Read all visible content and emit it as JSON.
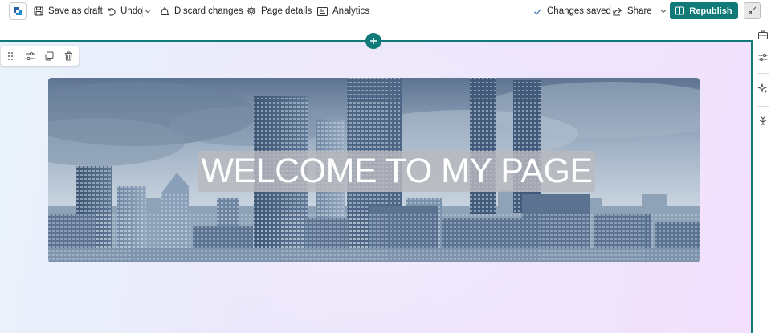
{
  "toolbar": {
    "logo_icon": "sharepoint-logo-icon",
    "save_draft": "Save as draft",
    "undo": "Undo",
    "discard": "Discard changes",
    "page_details": "Page details",
    "analytics": "Analytics",
    "status": "Changes saved",
    "share": "Share",
    "republish": "Republish"
  },
  "hero": {
    "title": "WELCOME TO MY PAGE"
  },
  "section_tools": [
    "drag-handle-icon",
    "section-settings-icon",
    "duplicate-icon",
    "delete-icon"
  ],
  "right_rail": [
    "toolbox-icon",
    "properties-icon",
    "design-ideas-icon",
    "pages-icon"
  ],
  "colors": {
    "accent": "#0f7a78",
    "canvas_bg": "#ece7fb",
    "hero_tint": "#6c88a8"
  }
}
